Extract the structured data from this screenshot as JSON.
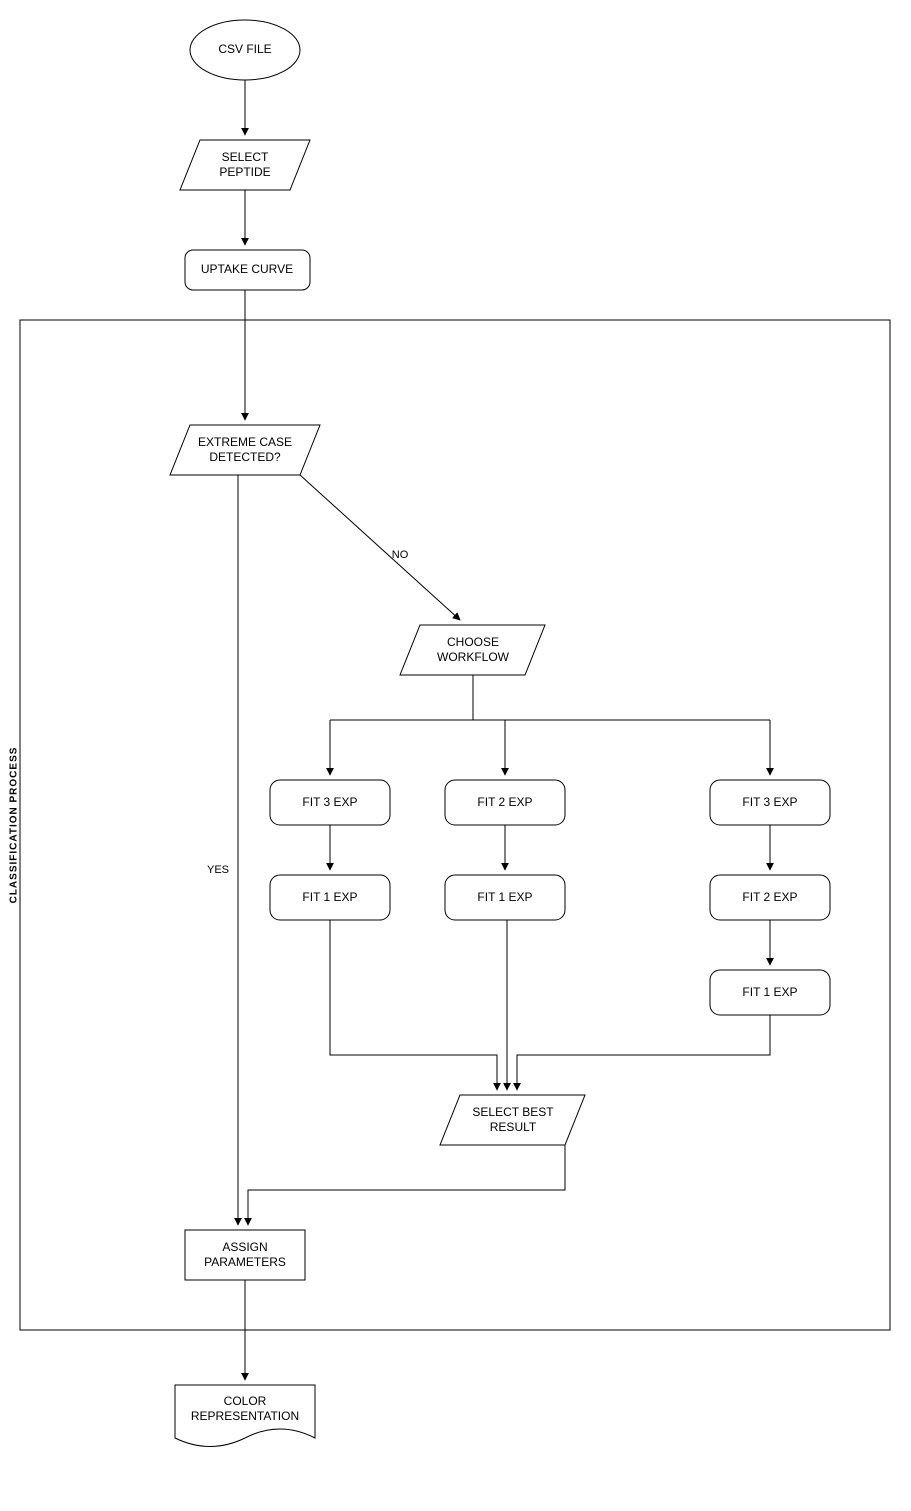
{
  "nodes": {
    "csv": "CSV FILE",
    "select_peptide": "SELECT\nPEPTIDE",
    "uptake_curve": "UPTAKE CURVE",
    "extreme": "EXTREME CASE\nDETECTED?",
    "choose_workflow": "CHOOSE\nWORKFLOW",
    "fit3a": "FIT 3 EXP",
    "fit2a": "FIT 2 EXP",
    "fit3c": "FIT 3 EXP",
    "fit1a": "FIT 1 EXP",
    "fit1b": "FIT 1 EXP",
    "fit2c": "FIT 2 EXP",
    "fit1c": "FIT 1 EXP",
    "select_best": "SELECT BEST\nRESULT",
    "assign_params": "ASSIGN\nPARAMETERS",
    "color_rep": "COLOR\nREPRESENTATION"
  },
  "edges": {
    "yes": "YES",
    "no": "NO"
  },
  "frame_label": "CLASSIFICATION PROCESS"
}
